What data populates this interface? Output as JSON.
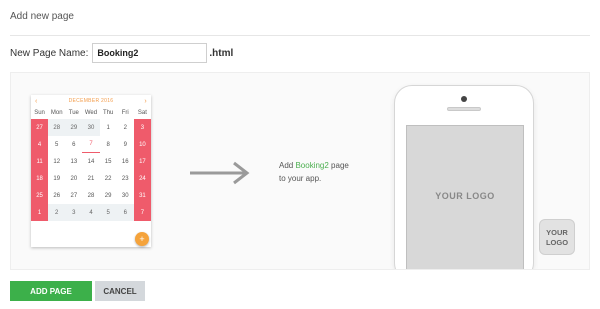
{
  "header": {
    "title": "Add new page"
  },
  "form": {
    "name_label": "New Page Name:",
    "name_value": "Booking2",
    "extension": ".html"
  },
  "calendar": {
    "month_label": "DECEMBER 2016",
    "weekdays": [
      "Sun",
      "Mon",
      "Tue",
      "Wed",
      "Thu",
      "Fri",
      "Sat"
    ],
    "weeks": [
      [
        "27",
        "28",
        "29",
        "30",
        "1",
        "2",
        "3"
      ],
      [
        "4",
        "5",
        "6",
        "7",
        "8",
        "9",
        "10"
      ],
      [
        "11",
        "12",
        "13",
        "14",
        "15",
        "16",
        "17"
      ],
      [
        "18",
        "19",
        "20",
        "21",
        "22",
        "23",
        "24"
      ],
      [
        "25",
        "26",
        "27",
        "28",
        "29",
        "30",
        "31"
      ],
      [
        "1",
        "2",
        "3",
        "4",
        "5",
        "6",
        "7"
      ]
    ],
    "fab_label": "+"
  },
  "preview": {
    "text_before": "Add ",
    "page_name": "Booking2",
    "text_after": " page",
    "line2": "to your app.",
    "screen_logo": "YOUR LOGO",
    "badge_line1": "YOUR",
    "badge_line2": "LOGO"
  },
  "actions": {
    "add_label": "ADD PAGE",
    "cancel_label": "CANCEL"
  },
  "colors": {
    "accent_green": "#3cb04a",
    "calendar_red": "#ef5b6b",
    "fab_orange": "#f5a33b"
  }
}
